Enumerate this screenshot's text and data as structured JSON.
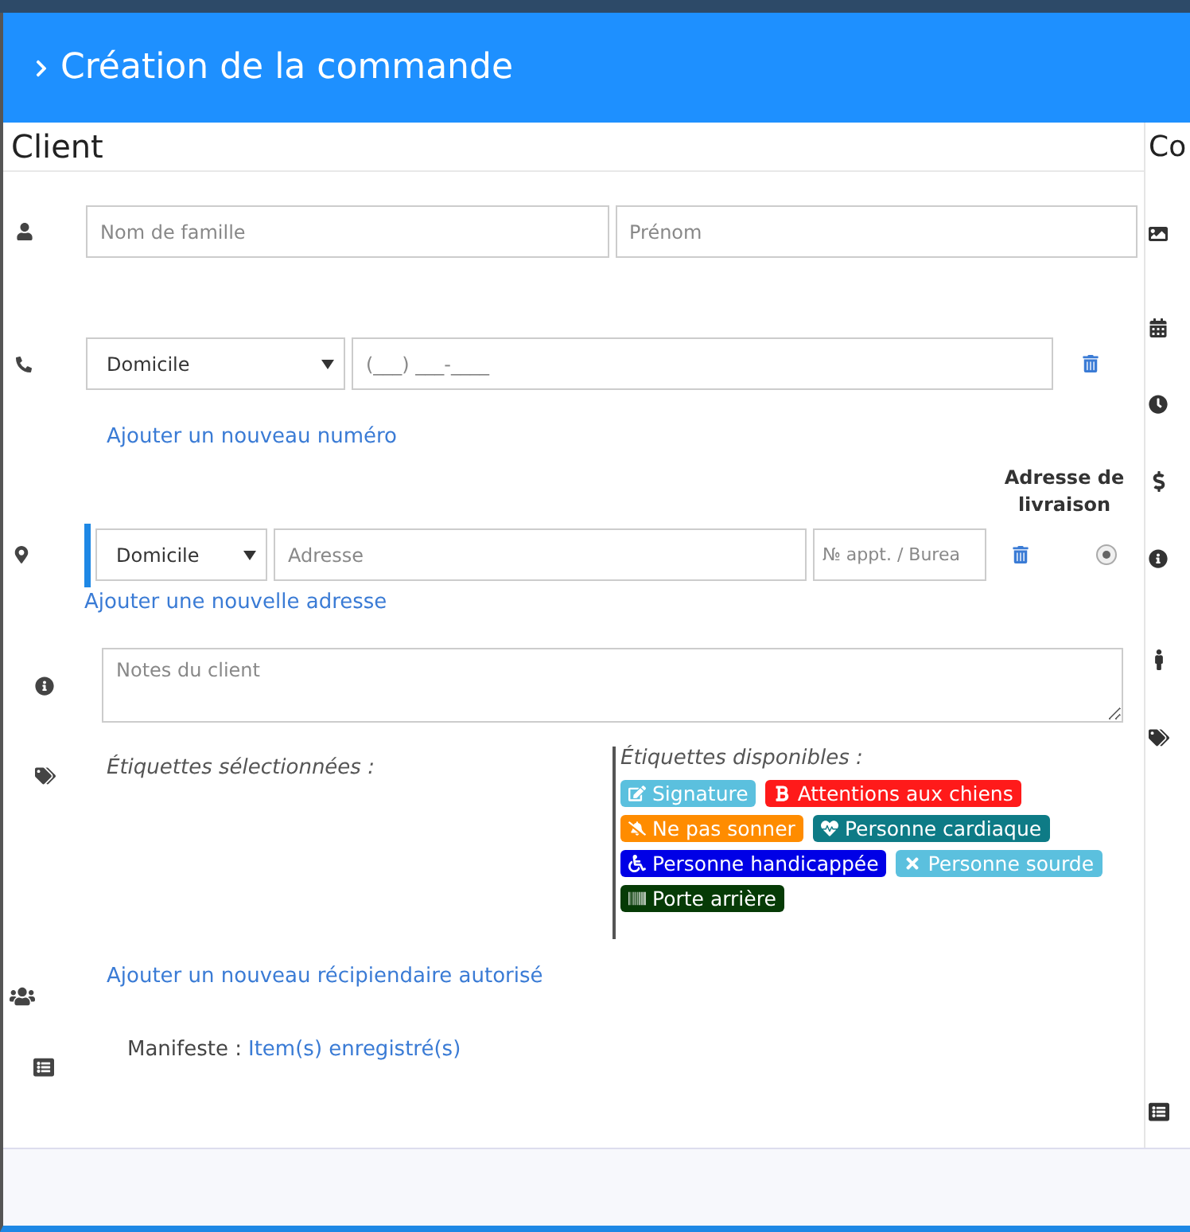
{
  "header": {
    "title": "Création de la commande"
  },
  "client": {
    "title": "Client",
    "name": {
      "last_name_placeholder": "Nom de famille",
      "first_name_placeholder": "Prénom"
    },
    "phone": {
      "type": "Domicile",
      "placeholder": "(___) ___-____"
    },
    "add_phone": "Ajouter un nouveau numéro",
    "delivery_header": "Adresse de livraison",
    "address": {
      "type": "Domicile",
      "placeholder": "Adresse",
      "unit_placeholder": "№ appt. / Burea",
      "selected": true
    },
    "add_address": "Ajouter une nouvelle adresse",
    "notes_placeholder": "Notes du client",
    "selected_tags_label": "Étiquettes sélectionnées :",
    "available_tags_label": "Étiquettes disponibles :",
    "available_tags": [
      {
        "label": "Signature",
        "color": "#5bc0de"
      },
      {
        "label": "Attentions aux chiens",
        "color": "#ff1a1a"
      },
      {
        "label": "Ne pas sonner",
        "color": "#ff8c00"
      },
      {
        "label": "Personne cardiaque",
        "color": "#0e7b86"
      },
      {
        "label": "Personne handicappée",
        "color": "#0000e6"
      },
      {
        "label": "Personne sourde",
        "color": "#5bc0de"
      },
      {
        "label": "Porte arrière",
        "color": "#063b06"
      }
    ],
    "add_recipient": "Ajouter un nouveau récipiendaire autorisé",
    "manifest_label": "Manifeste :",
    "manifest_link": "Item(s) enregistré(s)"
  },
  "side_column": {
    "title": "Co"
  }
}
